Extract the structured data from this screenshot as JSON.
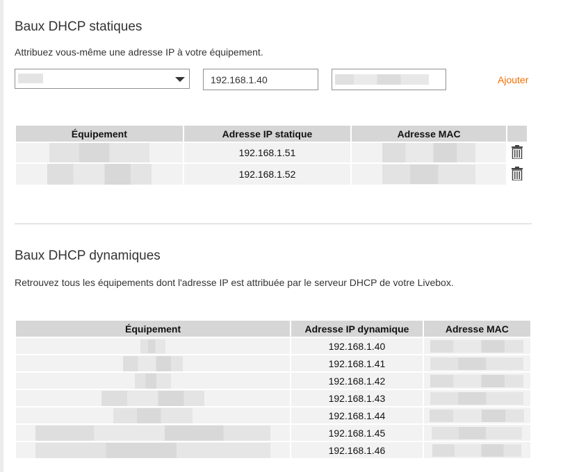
{
  "static_section": {
    "title": "Baux DHCP statiques",
    "description": "Attribuez vous-même une adresse IP à votre équipement.",
    "form": {
      "ip_value": "192.168.1.40",
      "add_label": "Ajouter"
    },
    "columns": [
      "Équipement",
      "Adresse IP statique",
      "Adresse MAC",
      ""
    ],
    "rows": [
      {
        "ip": "192.168.1.51"
      },
      {
        "ip": "192.168.1.52"
      }
    ]
  },
  "dynamic_section": {
    "title": "Baux DHCP dynamiques",
    "description": "Retrouvez tous les équipements dont l'adresse IP est attribuée par le serveur DHCP de votre Livebox.",
    "columns": [
      "Équipement",
      "Adresse IP dynamique",
      "Adresse MAC"
    ],
    "rows": [
      {
        "ip": "192.168.1.40"
      },
      {
        "ip": "192.168.1.41"
      },
      {
        "ip": "192.168.1.42"
      },
      {
        "ip": "192.168.1.43"
      },
      {
        "ip": "192.168.1.44"
      },
      {
        "ip": "192.168.1.45"
      },
      {
        "ip": "192.168.1.46"
      }
    ]
  },
  "colors": {
    "accent": "#f16e00",
    "header_bg": "#d6d6d6",
    "row_bg": "#f2f2f2"
  },
  "icons": {
    "delete": "trash-icon",
    "dropdown": "chevron-down-icon"
  }
}
